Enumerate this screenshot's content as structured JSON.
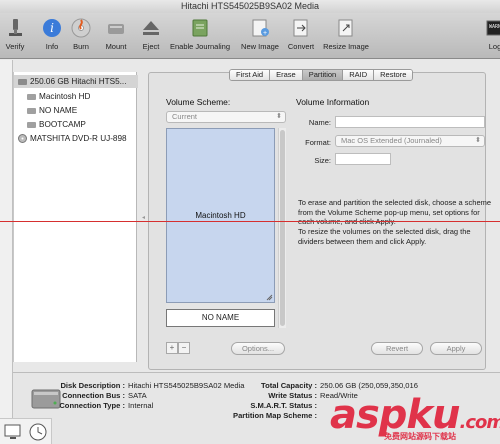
{
  "window": {
    "title": "Hitachi HTS545025B9SA02 Media"
  },
  "toolbar": {
    "items": [
      {
        "label": "Verify",
        "icon": "microscope-icon"
      },
      {
        "label": "Info",
        "icon": "info-icon"
      },
      {
        "label": "Burn",
        "icon": "burn-disc-icon"
      },
      {
        "label": "Mount",
        "icon": "mount-disk-icon"
      },
      {
        "label": "Eject",
        "icon": "eject-icon"
      },
      {
        "label": "Enable Journaling",
        "icon": "journal-icon"
      },
      {
        "label": "New Image",
        "icon": "new-image-icon"
      },
      {
        "label": "Convert",
        "icon": "convert-icon"
      },
      {
        "label": "Resize Image",
        "icon": "resize-image-icon"
      },
      {
        "label": "Log",
        "icon": "log-icon"
      }
    ]
  },
  "sidebar": {
    "items": [
      {
        "label": "250.06 GB Hitachi HTS5...",
        "icon": "hard-disk-icon",
        "selected": true
      },
      {
        "label": "Macintosh HD",
        "icon": "volume-icon"
      },
      {
        "label": "NO NAME",
        "icon": "volume-icon"
      },
      {
        "label": "BOOTCAMP",
        "icon": "volume-icon"
      },
      {
        "label": "MATSHITA DVD-R UJ-898",
        "icon": "optical-drive-icon"
      }
    ]
  },
  "tabs": [
    {
      "label": "First Aid"
    },
    {
      "label": "Erase"
    },
    {
      "label": "Partition",
      "active": true
    },
    {
      "label": "RAID"
    },
    {
      "label": "Restore"
    }
  ],
  "partition": {
    "scheme_heading": "Volume Scheme:",
    "scheme_value": "Current",
    "volumes": [
      {
        "name": "Macintosh HD"
      },
      {
        "name": "NO NAME"
      }
    ],
    "add_label": "+",
    "remove_label": "−",
    "options_label": "Options..."
  },
  "volume_info": {
    "heading": "Volume Information",
    "name_label": "Name:",
    "name_value": "",
    "format_label": "Format:",
    "format_value": "Mac OS Extended (Journaled)",
    "size_label": "Size:",
    "size_value": "",
    "help_1": "To erase and partition the selected disk, choose a scheme from the Volume Scheme pop-up menu, set options for each volume, and click Apply.",
    "help_2": "To resize the volumes on the selected disk, drag the dividers between them and click Apply.",
    "revert_label": "Revert",
    "apply_label": "Apply"
  },
  "details": {
    "disk_description_label": "Disk Description :",
    "disk_description_value": "Hitachi HTS545025B9SA02 Media",
    "connection_bus_label": "Connection Bus :",
    "connection_bus_value": "SATA",
    "connection_type_label": "Connection Type :",
    "connection_type_value": "Internal",
    "total_capacity_label": "Total Capacity :",
    "total_capacity_value": "250.06 GB (250,059,350,016",
    "write_status_label": "Write Status :",
    "write_status_value": "Read/Write",
    "smart_status_label": "S.M.A.R.T. Status :",
    "smart_status_value": "",
    "partition_map_label": "Partition Map Scheme :",
    "partition_map_value": ""
  },
  "watermark": {
    "brand": "aspku",
    "tld": ".com",
    "sub": "免费网站源码下载站"
  },
  "colors": {
    "selection": "#d4d4d4",
    "volume_fill": "#c7d6ee",
    "watermark": "#e0334a",
    "guide_line": "#d62f2f"
  }
}
